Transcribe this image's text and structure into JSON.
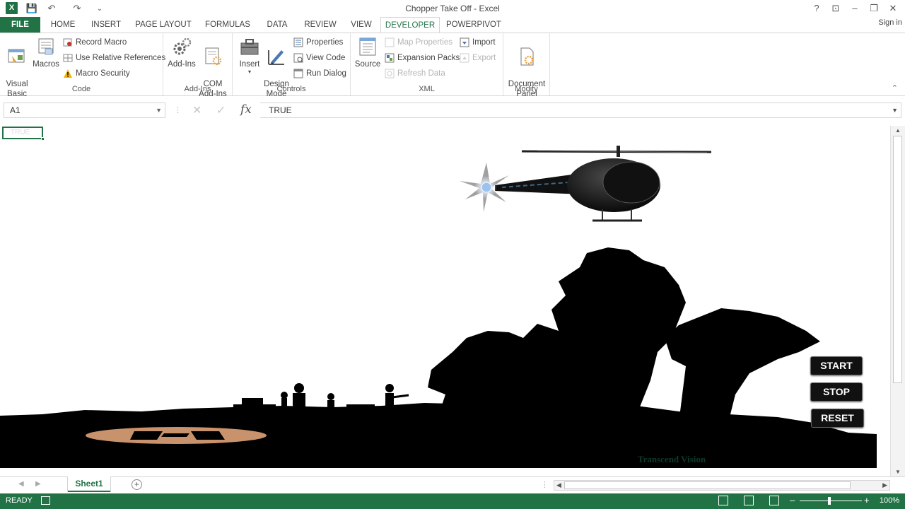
{
  "window": {
    "title": "Chopper Take Off - Excel",
    "help": "?",
    "minimize": "–",
    "restore": "❐",
    "close": "✕",
    "ribbon_display": "⊡",
    "signin": "Sign in"
  },
  "qat": {
    "save": "💾",
    "undo": "↶",
    "redo": "↷",
    "customize": "⌄"
  },
  "tabs": [
    {
      "label": "FILE"
    },
    {
      "label": "HOME"
    },
    {
      "label": "INSERT"
    },
    {
      "label": "PAGE LAYOUT"
    },
    {
      "label": "FORMULAS"
    },
    {
      "label": "DATA"
    },
    {
      "label": "REVIEW"
    },
    {
      "label": "VIEW"
    },
    {
      "label": "DEVELOPER"
    },
    {
      "label": "POWERPIVOT"
    }
  ],
  "ribbon": {
    "code": {
      "label": "Code",
      "visual_basic": "Visual\nBasic",
      "macros": "Macros",
      "record_macro": "Record Macro",
      "relative_refs": "Use Relative References",
      "macro_security": "Macro Security"
    },
    "addins": {
      "label": "Add-Ins",
      "addins": "Add-Ins",
      "com_addins": "COM\nAdd-Ins"
    },
    "controls": {
      "label": "Controls",
      "insert": "Insert",
      "design_mode": "Design\nMode",
      "properties": "Properties",
      "view_code": "View Code",
      "run_dialog": "Run Dialog"
    },
    "xml": {
      "label": "XML",
      "source": "Source",
      "map_properties": "Map Properties",
      "expansion_packs": "Expansion Packs",
      "refresh_data": "Refresh Data",
      "import": "Import",
      "export": "Export"
    },
    "modify": {
      "label": "Modify",
      "document_panel": "Document\nPanel"
    },
    "collapse": "⌃"
  },
  "formula_bar": {
    "name_box": "A1",
    "cancel": "✕",
    "enter": "✓",
    "fx": "fx",
    "value": "TRUE"
  },
  "cell_a1": "TRUE",
  "scene": {
    "watermark": "Transcend Vision",
    "buttons": {
      "start": "START",
      "stop": "STOP",
      "reset": "RESET"
    },
    "helipad_color": "#c8926c",
    "silhouette_color": "#000000"
  },
  "sheet_tabs": {
    "prev": "◀",
    "next": "▶",
    "active": "Sheet1",
    "add": "+"
  },
  "status": {
    "ready": "READY",
    "zoom": "100%",
    "zoom_minus": "–",
    "zoom_plus": "+"
  },
  "colors": {
    "accent": "#217346"
  }
}
